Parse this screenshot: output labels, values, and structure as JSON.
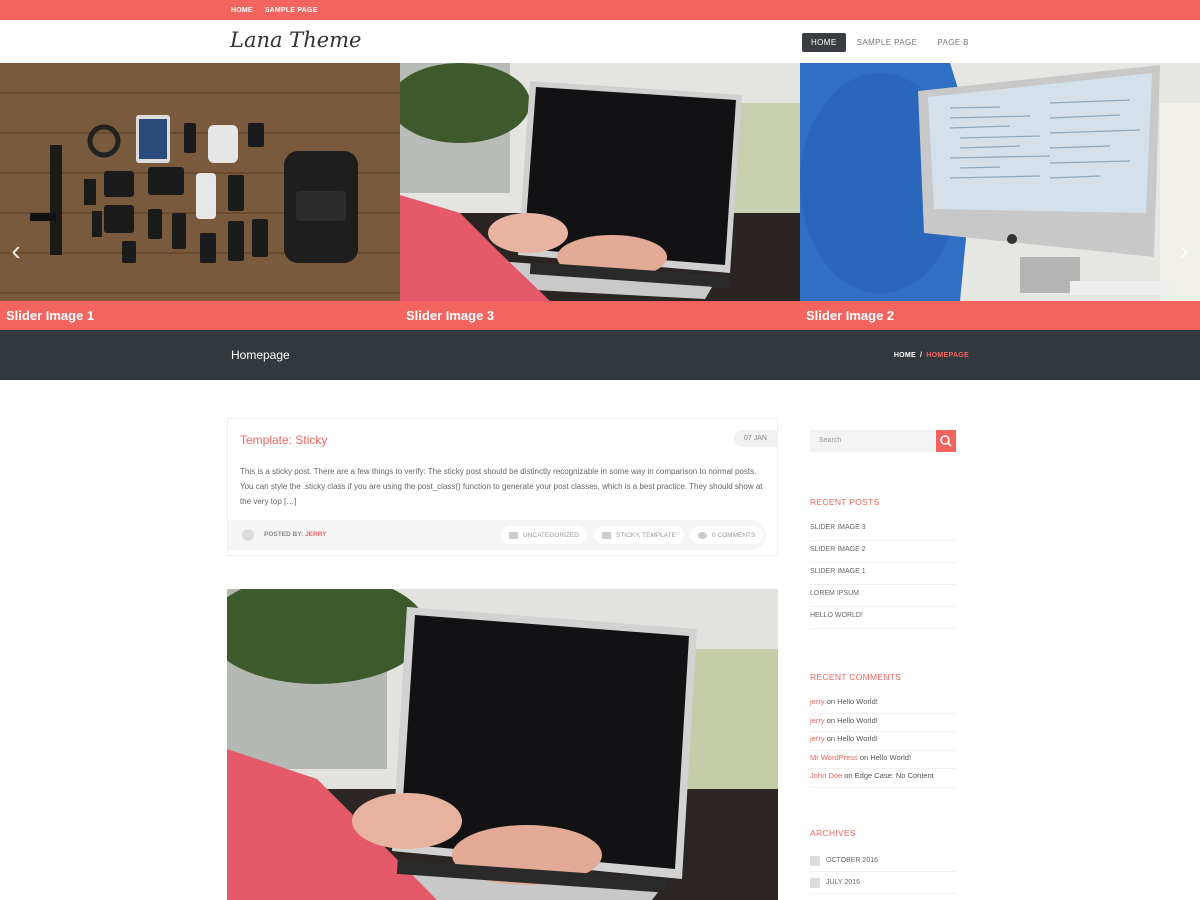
{
  "topbar": {
    "links": [
      "HOME",
      "SAMPLE PAGE"
    ]
  },
  "site": {
    "logo": "Lana Theme"
  },
  "nav": {
    "items": [
      "HOME",
      "SAMPLE PAGE",
      "PAGE B"
    ],
    "active": 0
  },
  "slider": {
    "captions": [
      "Slider Image 1",
      "Slider Image 3",
      "Slider Image 2"
    ],
    "prev_icon": "chevron-left-icon",
    "next_icon": "chevron-right-icon"
  },
  "pagetitle": {
    "title": "Homepage",
    "breadcrumb": [
      "HOME",
      "/",
      "HOMEPAGE"
    ]
  },
  "post": {
    "title": "Template: Sticky",
    "date": "07 JAN",
    "excerpt": "This is a sticky post. There are a few things to verify: The sticky post should be distinctly recognizable in some way in comparison to normal posts. You can style the .sticky class if you are using the post_class() function to generate your post classes, which is a best practice. They should show at the very top […]",
    "posted_by": "POSTED BY:",
    "author": "JERRY",
    "category": "UNCATEGORIZED",
    "tags": "STICKY, TEMPLATE",
    "comments": "0 COMMENTS"
  },
  "sidebar": {
    "search_placeholder": "Search",
    "recent_posts_title": "RECENT POSTS",
    "recent_posts": [
      "SLIDER IMAGE 3",
      "SLIDER IMAGE 2",
      "SLIDER IMAGE 1",
      "LOREM IPSUM",
      "HELLO WORLD!"
    ],
    "recent_comments_title": "RECENT COMMENTS",
    "recent_comments": [
      {
        "who": "jerry",
        "on": "on",
        "post": "Hello World!"
      },
      {
        "who": "jerry",
        "on": "on",
        "post": "Hello World!"
      },
      {
        "who": "jerry",
        "on": "on",
        "post": "Hello World!"
      },
      {
        "who": "Mr WordPress",
        "on": "on",
        "post": "Hello World!"
      },
      {
        "who": "John Doe",
        "on": "on",
        "post": "Edge Case: No Content"
      }
    ],
    "archives_title": "ARCHIVES",
    "archives": [
      "OCTOBER 2016",
      "JULY 2016"
    ]
  },
  "colors": {
    "accent": "#f4645f",
    "dark": "#33383d"
  }
}
